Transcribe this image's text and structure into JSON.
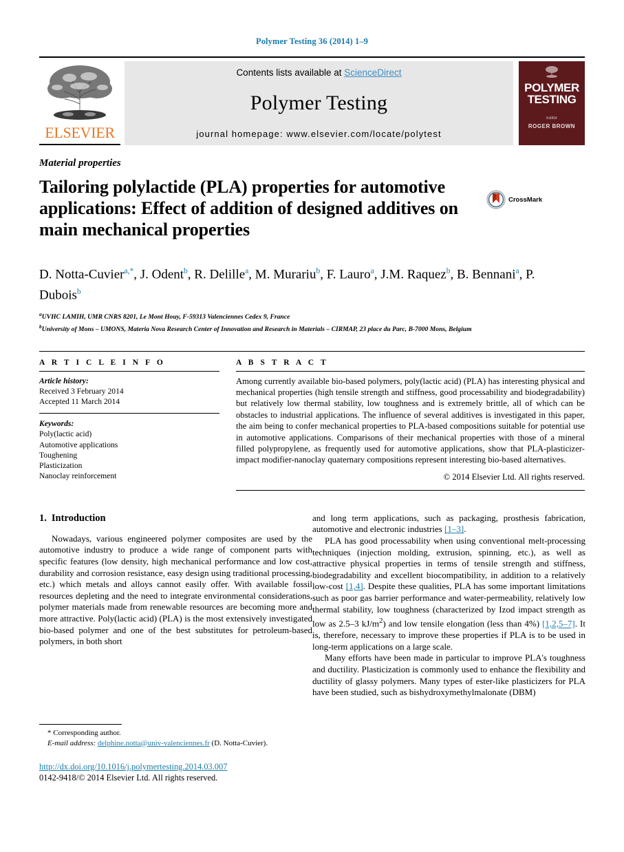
{
  "running_head": "Polymer Testing 36 (2014) 1–9",
  "masthead": {
    "publisher": "ELSEVIER",
    "contents_prefix": "Contents lists available at ",
    "sciencedirect": "ScienceDirect",
    "journal_title": "Polymer Testing",
    "homepage": "journal homepage: www.elsevier.com/locate/polytest",
    "cover": {
      "title_line1": "POLYMER",
      "title_line2": "TESTING",
      "editor_label": "Editor",
      "editor_name": "ROGER BROWN"
    }
  },
  "article": {
    "section_label": "Material properties",
    "title": "Tailoring polylactide (PLA) properties for automotive applications: Effect of addition of designed additives on main mechanical properties",
    "crossmark_label": "CrossMark",
    "authors": [
      {
        "name": "D. Notta-Cuvier",
        "marks": "a,*",
        "sep": ", "
      },
      {
        "name": "J. Odent",
        "marks": "b",
        "sep": ", "
      },
      {
        "name": "R. Delille",
        "marks": "a",
        "sep": ", "
      },
      {
        "name": "M. Murariu",
        "marks": "b",
        "sep": ", "
      },
      {
        "name": "F. Lauro",
        "marks": "a",
        "sep": ", "
      },
      {
        "name": "J.M. Raquez",
        "marks": "b",
        "sep": ", "
      },
      {
        "name": "B. Bennani",
        "marks": "a",
        "sep": ", "
      },
      {
        "name": "P. Dubois",
        "marks": "b",
        "sep": ""
      }
    ],
    "affiliations": [
      {
        "mark": "a",
        "text": "UVHC LAMIH, UMR CNRS 8201, Le Mont Houy, F-59313 Valenciennes Cedex 9, France"
      },
      {
        "mark": "b",
        "text": "University of Mons – UMONS, Materia Nova Research Center of Innovation and Research in Materials – CIRMAP, 23 place du Parc, B-7000 Mons, Belgium"
      }
    ]
  },
  "article_info": {
    "heading": "A R T I C L E  I N F O",
    "history_label": "Article history:",
    "history": [
      "Received 3 February 2014",
      "Accepted 11 March 2014"
    ],
    "keywords_label": "Keywords:",
    "keywords": [
      "Poly(lactic acid)",
      "Automotive applications",
      "Toughening",
      "Plasticization",
      "Nanoclay reinforcement"
    ]
  },
  "abstract": {
    "heading": "A B S T R A C T",
    "text": "Among currently available bio-based polymers, poly(lactic acid) (PLA) has interesting physical and mechanical properties (high tensile strength and stiffness, good processability and biodegradability) but relatively low thermal stability, low toughness and is extremely brittle, all of which can be obstacles to industrial applications. The influence of several additives is investigated in this paper, the aim being to confer mechanical properties to PLA-based compositions suitable for potential use in automotive applications. Comparisons of their mechanical properties with those of a mineral filled polypropylene, as frequently used for automotive applications, show that PLA-plasticizer-impact modifier-nanoclay quaternary compositions represent interesting bio-based alternatives.",
    "copyright": "© 2014 Elsevier Ltd. All rights reserved."
  },
  "body": {
    "heading_number": "1.",
    "heading_text": "Introduction",
    "left_paragraphs": [
      "Nowadays, various engineered polymer composites are used by the automotive industry to produce a wide range of component parts with specific features (low density, high mechanical performance and low cost, durability and corrosion resistance, easy design using traditional processing, etc.) which metals and alloys cannot easily offer. With available fossil resources depleting and the need to integrate environmental considerations, polymer materials made from renewable resources are becoming more and more attractive. Poly(lactic acid) (PLA) is the most extensively investigated bio-based polymer and one of the best substitutes for petroleum-based polymers, in both short"
    ],
    "right_paragraph_1_continuation": "and long term applications, such as packaging, prosthesis fabrication, automotive and electronic industries ",
    "right_ref_1": "[1–3]",
    "right_ref_1_after": ".",
    "right_paragraph_2_a": "PLA has good processability when using conventional melt-processing techniques (injection molding, extrusion, spinning, etc.), as well as attractive physical properties in terms of tensile strength and stiffness, biodegradability and excellent biocompatibility, in addition to a relatively low-cost ",
    "right_ref_2": "[1,4]",
    "right_paragraph_2_b": ". Despite these qualities, PLA has some important limitations such as poor gas barrier performance and water-permeability, relatively low thermal stability, low toughness (characterized by Izod impact strength as low as 2.5–3 kJ/m",
    "right_sup_2": "2",
    "right_paragraph_2_c": ") and low tensile elongation (less than 4%) ",
    "right_ref_3": "[1,2,5–7]",
    "right_paragraph_2_d": ". It is, therefore, necessary to improve these properties if PLA is to be used in long-term applications on a large scale.",
    "right_paragraph_3": "Many efforts have been made in particular to improve PLA's toughness and ductility. Plasticization is commonly used to enhance the flexibility and ductility of glassy polymers. Many types of ester-like plasticizers for PLA have been studied, such as bishydroxymethylmalonate (DBM)"
  },
  "footnotes": {
    "corresponding": "* Corresponding author.",
    "email_label": "E-mail address:",
    "email": "delphine.notta@univ-valenciennes.fr",
    "email_suffix": "(D. Notta-Cuvier).",
    "doi": "http://dx.doi.org/10.1016/j.polymertesting.2014.03.007",
    "issn_line": "0142-9418/© 2014 Elsevier Ltd. All rights reserved."
  },
  "colors": {
    "link": "#1a7bab",
    "sciencedirect": "#3c8fc4",
    "elsevier_orange": "#e87722",
    "cover_maroon": "#5d1a1d",
    "banner_gray": "#e7e7e7"
  }
}
